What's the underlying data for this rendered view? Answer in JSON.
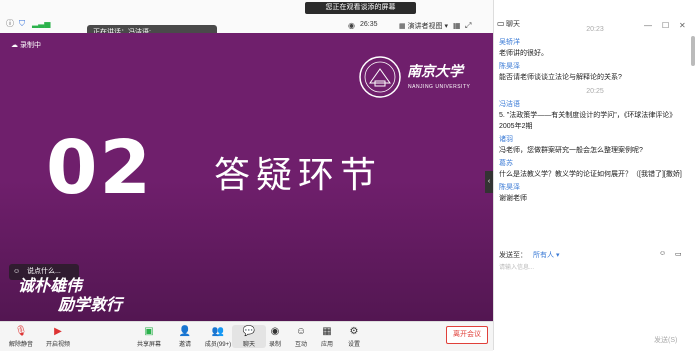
{
  "banner": "您正在观看谈添的屏幕",
  "speaking": {
    "label": "正在讲话：",
    "name": "冯洁语;"
  },
  "timer": "26:35",
  "view_mode": "演讲者视图",
  "slide": {
    "recording": "录制中",
    "number": "02",
    "title": "答疑环节",
    "logo_zh": "南京大学",
    "logo_en": "NANJING UNIVERSITY",
    "motto_1": "诚朴雄伟",
    "motto_2": "励学敦行",
    "chat_overlay": "说点什么..."
  },
  "toolbar": {
    "mute": "解除静音",
    "video": "开启视频",
    "share": "共享屏幕",
    "invite": "邀请",
    "members": "成员(99+)",
    "chat": "聊天",
    "record": "录制",
    "reactions": "互动",
    "apps": "应用",
    "settings": "设置",
    "leave": "离开会议"
  },
  "chat": {
    "title": "聊天",
    "messages": [
      {
        "type": "time",
        "text": "20:23"
      },
      {
        "sender": "吴轿洋",
        "text": "老师讲的很好。"
      },
      {
        "sender": "陈昊泽",
        "text": "能否请老师谈谈立法论与解释论的关系?"
      },
      {
        "type": "time",
        "text": "20:25"
      },
      {
        "sender": "冯洁语",
        "text": "5. \"法政策学——有关制度设计的学问\"，《环球法律评论》2005年2期"
      },
      {
        "sender": "诸羽",
        "text": "冯老师，您做群案研究一般会怎么整理案例呢?"
      },
      {
        "sender": "葛苏",
        "text": "什么是法教义学？教义学的论证如何展开？（[我错了][撒娇]"
      },
      {
        "sender": "陈昊泽",
        "text": "谢谢老师"
      }
    ],
    "send_to_label": "发送至：",
    "send_to_value": "所有人",
    "input_placeholder": "请输入信息...",
    "send": "发送(S)"
  },
  "colors": {
    "slide_bg": "#6f1f6c",
    "accent": "#3b7bd6",
    "leave": "#e0403a"
  }
}
